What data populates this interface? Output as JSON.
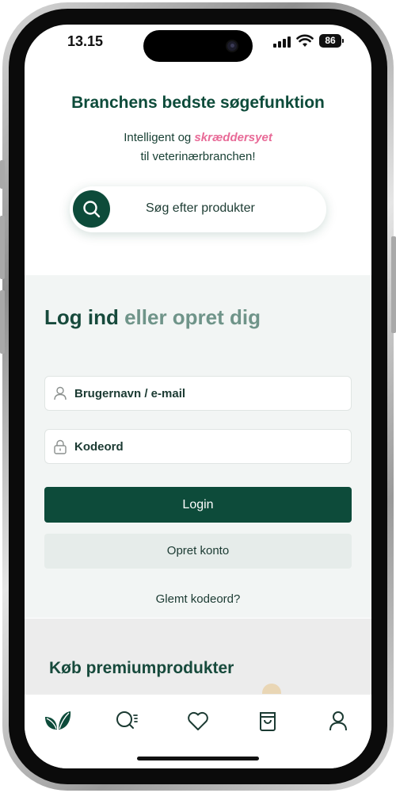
{
  "status_bar": {
    "time": "13.15",
    "battery": "86"
  },
  "hero": {
    "title": "Branchens bedste søgefunktion",
    "subtitle_pre": "Intelligent og ",
    "subtitle_highlight": "skræddersyet",
    "subtitle_line2": "til veterinærbranchen!",
    "search_placeholder": "Søg efter produkter"
  },
  "login": {
    "title_strong": "Log ind",
    "title_light": " eller opret dig",
    "username_label": "Brugernavn / e-mail",
    "password_label": "Kodeord",
    "login_button": "Login",
    "create_button": "Opret konto",
    "forgot_link": "Glemt kodeord?"
  },
  "promo": {
    "text": "Køb premiumprodukter"
  },
  "tabbar": {
    "items": [
      {
        "icon": "leaf-icon"
      },
      {
        "icon": "search-list-icon"
      },
      {
        "icon": "heart-icon"
      },
      {
        "icon": "bag-icon"
      },
      {
        "icon": "user-icon"
      }
    ]
  },
  "colors": {
    "brand": "#0d4b3a",
    "accent": "#e86a97",
    "brand_light": "#6f9489"
  }
}
